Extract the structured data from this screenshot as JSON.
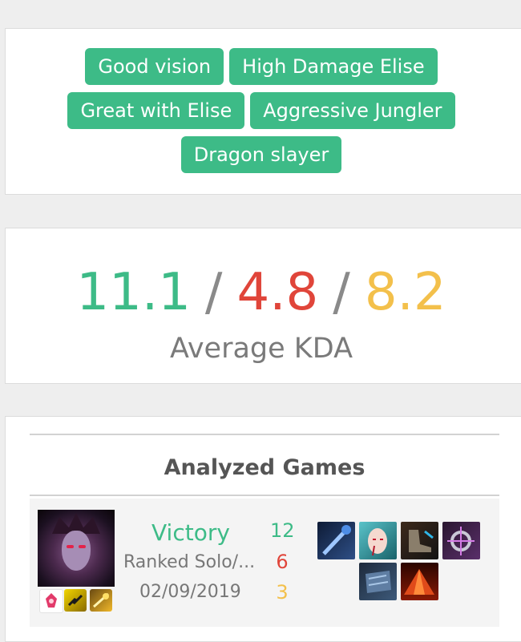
{
  "tags": [
    "Good vision",
    "High Damage Elise",
    "Great with Elise",
    "Aggressive Jungler",
    "Dragon slayer"
  ],
  "kda": {
    "kills": "11.1",
    "deaths": "4.8",
    "assists": "8.2",
    "separator": "/",
    "label": "Average KDA"
  },
  "colors": {
    "tag_bg": "#3dbb87",
    "kills": "#3dbb87",
    "deaths": "#e0453a",
    "assists": "#f3c04b",
    "victory": "#3dbb87"
  },
  "games": {
    "title": "Analyzed Games",
    "rows": [
      {
        "champion_icon": "elise-champion-portrait",
        "spells": [
          "rune-icon",
          "flash-spell-icon",
          "smite-spell-icon"
        ],
        "result": "Victory",
        "queue": "Ranked Solo/...",
        "date": "02/09/2019",
        "kills": "12",
        "deaths": "6",
        "assists": "3",
        "items": [
          "staff-item-icon",
          "elise-ward-icon",
          "boots-item-icon",
          "hextech-item-icon",
          "armor-item-icon",
          "red-tent-item-icon"
        ]
      }
    ]
  }
}
